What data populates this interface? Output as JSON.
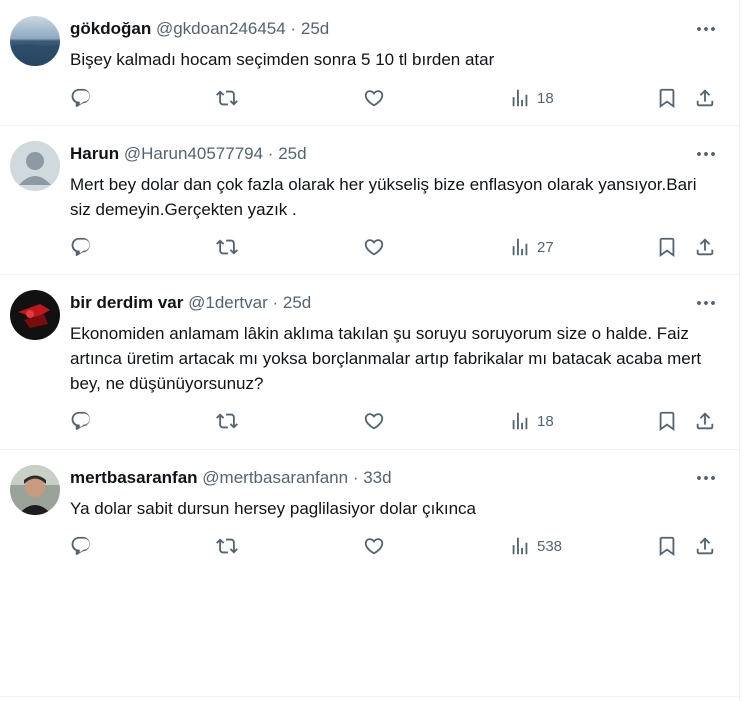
{
  "tweets": [
    {
      "name": "gökdoğan",
      "handle": "@gkdoan246454",
      "time": "25d",
      "text": "Bişey kalmadı hocam seçimden sonra 5 10 tl bırden atar",
      "views": "18",
      "avatar": "sea-photo"
    },
    {
      "name": "Harun",
      "handle": "@Harun40577794",
      "time": "25d",
      "text": "Mert bey dolar dan çok fazla olarak her yükseliş bize enflasyon olarak yansıyor.Bari siz demeyin.Gerçekten yazık .",
      "views": "27",
      "avatar": "default-user"
    },
    {
      "name": "bir derdim var",
      "handle": "@1dertvar",
      "time": "25d",
      "text": "Ekonomiden anlamam lâkin aklıma takılan şu soruyu soruyorum size o halde. Faiz artınca üretim artacak mı yoksa borçlanmalar artıp fabrikalar mı batacak acaba mert bey, ne düşünüyorsunuz?",
      "views": "18",
      "avatar": "red-dark-photo"
    },
    {
      "name": "mertbasaranfan",
      "handle": "@mertbasaranfann",
      "time": "33d",
      "text": "Ya dolar sabit dursun hersey paglilasiyor dolar çıkınca",
      "views": "538",
      "avatar": "person-photo"
    }
  ],
  "separator": "·",
  "icons": [
    "reply-icon",
    "retweet-icon",
    "like-icon",
    "views-icon",
    "bookmark-icon",
    "share-icon",
    "more-icon"
  ],
  "colors": {
    "text": "#0f1419",
    "secondary": "#536471",
    "border": "#eff3f4"
  }
}
